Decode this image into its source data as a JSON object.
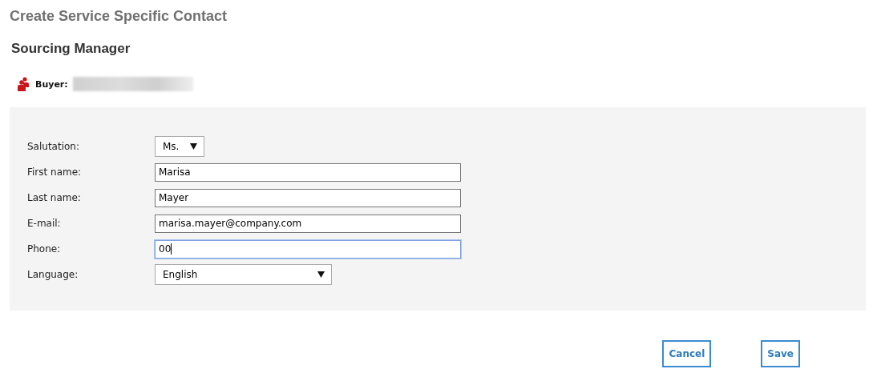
{
  "page_title": "Create Service Specific Contact",
  "section_title": "Sourcing Manager",
  "buyer": {
    "label": "Buyer:"
  },
  "form": {
    "fields": [
      {
        "kind": "select",
        "label": "Salutation:",
        "value": "Ms.",
        "focused": false
      },
      {
        "kind": "text",
        "label": "First name:",
        "value": "Marisa",
        "focused": false
      },
      {
        "kind": "text",
        "label": "Last name:",
        "value": "Mayer",
        "focused": false
      },
      {
        "kind": "text",
        "label": "E-mail:",
        "value": "marisa.mayer@company.com",
        "focused": false
      },
      {
        "kind": "text",
        "label": "Phone:",
        "value": "00",
        "focused": true
      },
      {
        "kind": "select-wide",
        "label": "Language:",
        "value": "English",
        "focused": false
      }
    ]
  },
  "buttons": [
    {
      "label": "Cancel"
    },
    {
      "label": "Save"
    }
  ]
}
